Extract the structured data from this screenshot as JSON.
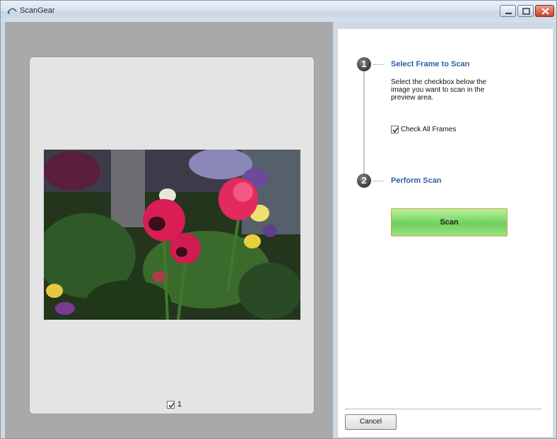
{
  "window": {
    "title": "ScanGear"
  },
  "preview": {
    "frame_number": "1",
    "frame_checked": true,
    "image_alt": "tulips-and-pansies-photo"
  },
  "steps": [
    {
      "number": "1",
      "title": "Select Frame to Scan",
      "description": "Select the checkbox below the image you want to scan in the preview area.",
      "checkbox_label": "Check All Frames",
      "checkbox_checked": true
    },
    {
      "number": "2",
      "title": "Perform Scan",
      "button_label": "Scan"
    }
  ],
  "footer": {
    "cancel_label": "Cancel"
  },
  "colors": {
    "accent": "#2f5ea8",
    "scan_button": "#7ed86a",
    "titlebar": "#d7e2ee"
  }
}
